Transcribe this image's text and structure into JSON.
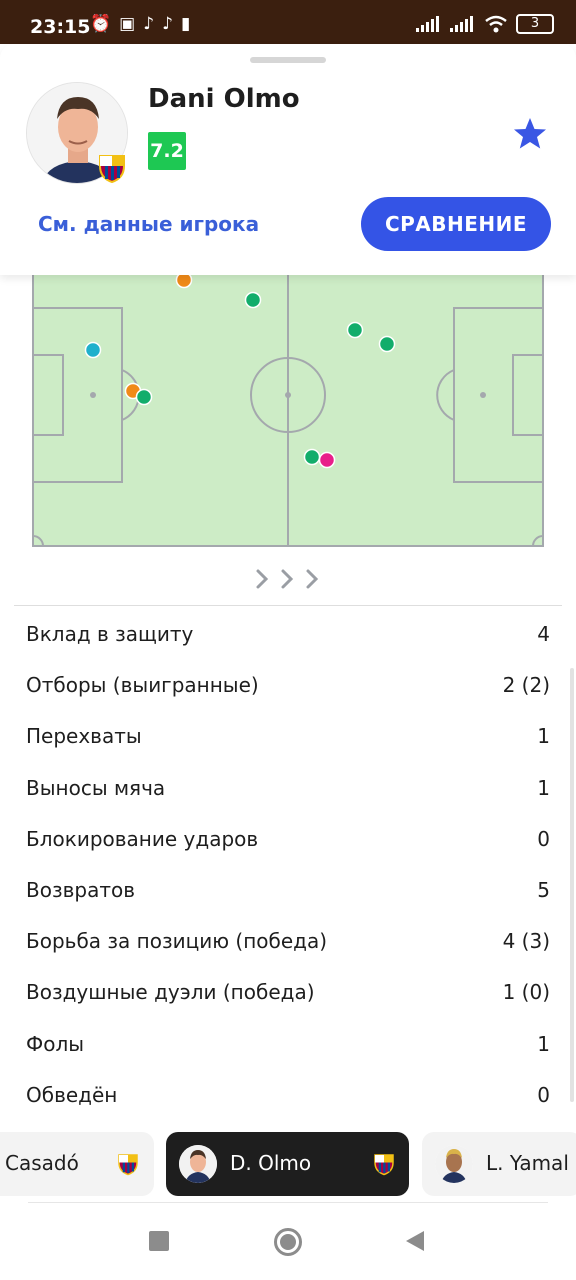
{
  "status_bar": {
    "time": "23:15",
    "battery": "3",
    "left_icons": [
      "alarm-icon",
      "nfc-icon",
      "tiktok-icon",
      "tiktok-icon",
      "battery-saver-icon"
    ],
    "right_icons": [
      "signal-icon",
      "signal-icon",
      "wifi-icon",
      "battery-icon"
    ]
  },
  "player": {
    "name": "Dani Olmo",
    "rating": "7.2",
    "rating_color": "#1ec853",
    "favorite_icon": "star-icon"
  },
  "actions": {
    "player_link": "См. данные игрока",
    "compare_button": "СРАВНЕНИЕ"
  },
  "pitch": {
    "background": "#cdecc6",
    "line_color": "#a4a8ad",
    "events_count": 10
  },
  "stats": [
    {
      "label": "Вклад в защиту",
      "value": "4"
    },
    {
      "label": "Отборы (выигранные)",
      "value": "2 (2)"
    },
    {
      "label": "Перехваты",
      "value": "1"
    },
    {
      "label": "Выносы мяча",
      "value": "1"
    },
    {
      "label": "Блокирование ударов",
      "value": "0"
    },
    {
      "label": "Возвратов",
      "value": "5"
    },
    {
      "label": "Борьба за позицию (победа)",
      "value": "4 (3)"
    },
    {
      "label": "Воздушные дуэли (победа)",
      "value": "1 (0)"
    },
    {
      "label": "Фолы",
      "value": "1"
    },
    {
      "label": "Обведён",
      "value": "0"
    }
  ],
  "player_chips": [
    {
      "name": "Casadó",
      "active": false
    },
    {
      "name": "D. Olmo",
      "active": true
    },
    {
      "name": "L. Yamal",
      "active": false
    }
  ],
  "nav": [
    "recent-apps-icon",
    "home-icon",
    "back-icon"
  ]
}
